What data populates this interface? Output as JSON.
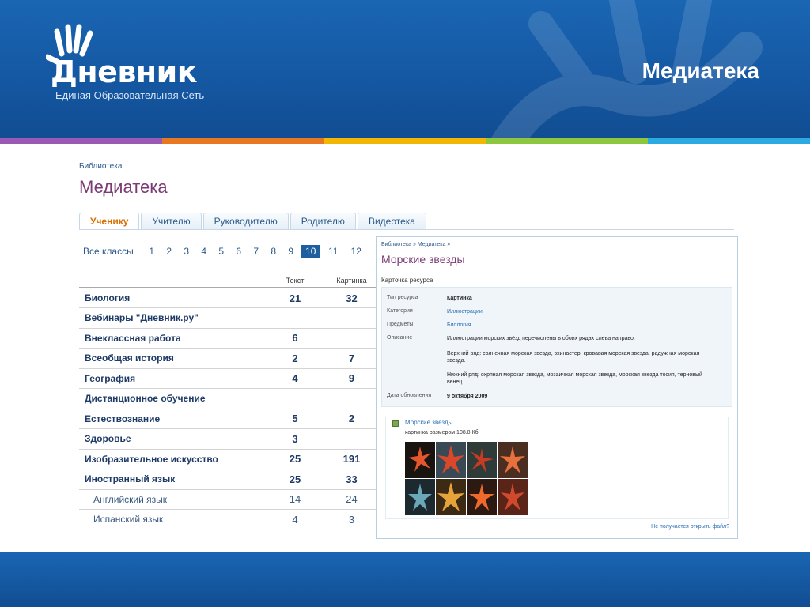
{
  "header": {
    "logo_word": "Дневник",
    "logo_subtitle": "Единая Образовательная Сеть",
    "heading": "Медиатека"
  },
  "stripe_colors": [
    "#9b59b6",
    "#e87722",
    "#f2b705",
    "#8dc63f",
    "#2ba9e1"
  ],
  "page": {
    "breadcrumb": "Библиотека",
    "title": "Медиатека"
  },
  "tabs": [
    "Ученику",
    "Учителю",
    "Руководителю",
    "Родителю",
    "Видеотека"
  ],
  "classes": {
    "all_label": "Все классы",
    "numbers": [
      "1",
      "2",
      "3",
      "4",
      "5",
      "6",
      "7",
      "8",
      "9",
      "10",
      "11",
      "12"
    ],
    "active": "10"
  },
  "table": {
    "headers": [
      "Текст",
      "Картинка"
    ],
    "rows": [
      {
        "name": "Биология",
        "text": "21",
        "image": "32",
        "sub": false
      },
      {
        "name": "Вебинары \"Дневник.ру\"",
        "text": "",
        "image": "",
        "sub": false
      },
      {
        "name": "Внеклассная работа",
        "text": "6",
        "image": "",
        "sub": false
      },
      {
        "name": "Всеобщая история",
        "text": "2",
        "image": "7",
        "sub": false
      },
      {
        "name": "География",
        "text": "4",
        "image": "9",
        "sub": false
      },
      {
        "name": "Дистанционное обучение",
        "text": "",
        "image": "",
        "sub": false
      },
      {
        "name": "Естествознание",
        "text": "5",
        "image": "2",
        "sub": false
      },
      {
        "name": "Здоровье",
        "text": "3",
        "image": "",
        "sub": false
      },
      {
        "name": "Изобразительное искусство",
        "text": "25",
        "image": "191",
        "sub": false
      },
      {
        "name": "Иностранный язык",
        "text": "25",
        "image": "33",
        "sub": false
      },
      {
        "name": "Английский язык",
        "text": "14",
        "image": "24",
        "sub": true
      },
      {
        "name": "Испанский язык",
        "text": "4",
        "image": "3",
        "sub": true
      }
    ]
  },
  "panel": {
    "breadcrumb": "Библиотека » Медиатека »",
    "title": "Морские звезды",
    "card_label": "Карточка ресурса",
    "fields": {
      "type_label": "Тип ресурса",
      "type_value": "Картинка",
      "category_label": "Категории",
      "category_value": "Иллюстрации",
      "subject_label": "Предметы",
      "subject_value": "Биология",
      "desc_label": "Описание",
      "desc_1": "Иллюстрации морских звёзд перечислены в обоих рядах слева направо.",
      "desc_2": "Верхний ряд: солнечная морская звезда, эхинастер, кровавая морская звезда, радужная морская звезда.",
      "desc_3": "Нижний ряд: охряная морская звезда, мозаичная морская звезда, морская звезда тосия, терновый венец.",
      "date_label": "Дата обновления",
      "date_value": "9 октября 2009"
    },
    "file_name": "Морские звезды",
    "file_size": "картинка размером 108.8 Кб",
    "help_link": "Не получается открыть файл?"
  }
}
